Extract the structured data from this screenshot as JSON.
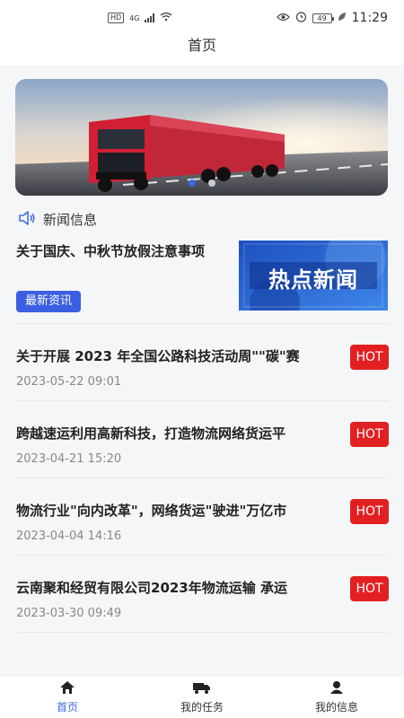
{
  "status_bar": {
    "network_badge": "HD",
    "network_type": "4G",
    "battery": "49",
    "time": "11:29"
  },
  "page_title": "首页",
  "banner": {
    "image": "red-truck-on-highway-sunset",
    "dot_count": 2,
    "active_dot": 0
  },
  "news_section": {
    "title": "新闻信息",
    "icon": "speaker-icon"
  },
  "featured": {
    "title": "关于国庆、中秋节放假注意事项",
    "tag": "最新资讯",
    "image_text": "热点新闻"
  },
  "news": [
    {
      "title": "关于开展 2023 年全国公路科技活动周\"\"碳\"赛",
      "date": "2023-05-22 09:01",
      "badge": "HOT"
    },
    {
      "title": "跨越速运利用高新科技，打造物流网络货运平",
      "date": "2023-04-21 15:20",
      "badge": "HOT"
    },
    {
      "title": "物流行业\"向内改革\"，网络货运\"驶进\"万亿市",
      "date": "2023-04-04 14:16",
      "badge": "HOT"
    },
    {
      "title": "云南聚和经贸有限公司2023年物流运输 承运",
      "date": "2023-03-30 09:49",
      "badge": "HOT"
    }
  ],
  "tabbar": {
    "items": [
      {
        "label": "首页",
        "icon": "home-icon",
        "active": true
      },
      {
        "label": "我的任务",
        "icon": "truck-icon",
        "active": false
      },
      {
        "label": "我的信息",
        "icon": "user-icon",
        "active": false
      }
    ]
  },
  "colors": {
    "accent": "#3a6be0",
    "tag": "#3b5fe2",
    "hot": "#e32021",
    "background": "#f5f6f8"
  }
}
